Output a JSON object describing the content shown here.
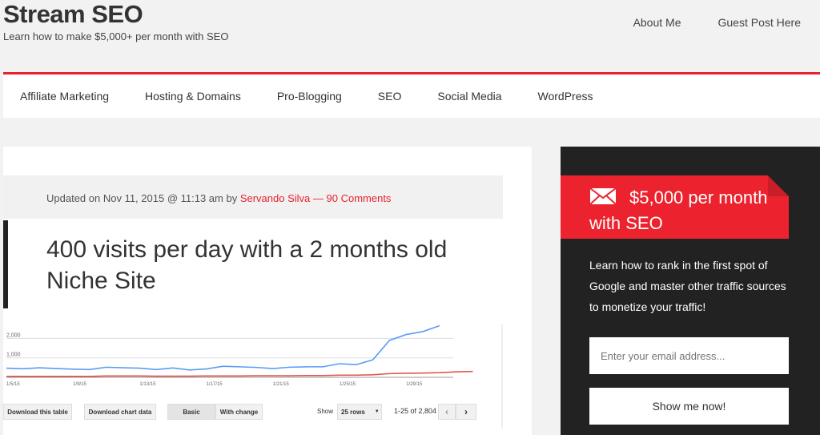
{
  "header": {
    "title": "Stream SEO",
    "tagline": "Learn how to make $5,000+ per month with SEO",
    "links": [
      "About Me",
      "Guest Post Here"
    ]
  },
  "nav": {
    "items": [
      "Affiliate Marketing",
      "Hosting & Domains",
      "Pro-Blogging",
      "SEO",
      "Social Media",
      "WordPress"
    ]
  },
  "post": {
    "meta_prefix": "Updated on Nov 11, 2015 @ 11:13 am by ",
    "author": "Servando Silva",
    "sep": " — ",
    "comments": "90 Comments",
    "title": "400 visits per day with a 2 months old Niche Site"
  },
  "post_image": {
    "buttons": [
      "Download this table",
      "Download chart data",
      "Basic",
      "With change"
    ],
    "show_label": "Show",
    "rows_select": "25 rows",
    "pagination": "1-25 of 2,804",
    "chart_data": {
      "type": "line",
      "x_labels": [
        "1/5/15",
        "1/9/15",
        "1/13/15",
        "1/17/15",
        "1/21/15",
        "1/25/15",
        "1/29/15"
      ],
      "y_ticks": [
        "1,000",
        "2,000"
      ],
      "ylim": [
        0,
        2800
      ],
      "series": [
        {
          "color": "#5b9cf5",
          "values": [
            470,
            440,
            490,
            450,
            420,
            400,
            520,
            490,
            470,
            400,
            480,
            380,
            430,
            570,
            540,
            510,
            450,
            520,
            540,
            540,
            700,
            650,
            900,
            1900,
            2200,
            2350,
            2650
          ]
        },
        {
          "color": "#e0584f",
          "values": [
            50,
            50,
            50,
            50,
            50,
            50,
            70,
            70,
            70,
            60,
            60,
            60,
            70,
            70,
            70,
            80,
            80,
            80,
            90,
            90,
            110,
            110,
            130,
            190,
            210,
            220,
            240,
            280,
            300
          ]
        }
      ]
    }
  },
  "sidebar": {
    "promo_title": "$5,000 per month with SEO",
    "promo_text": "Learn how to rank in the first spot of Google and master other traffic sources to monetize your traffic!",
    "email_placeholder": "Enter your email address...",
    "submit": "Show me now!"
  },
  "colors": {
    "accent": "#e8232f",
    "sidebar_bg": "#222222"
  }
}
